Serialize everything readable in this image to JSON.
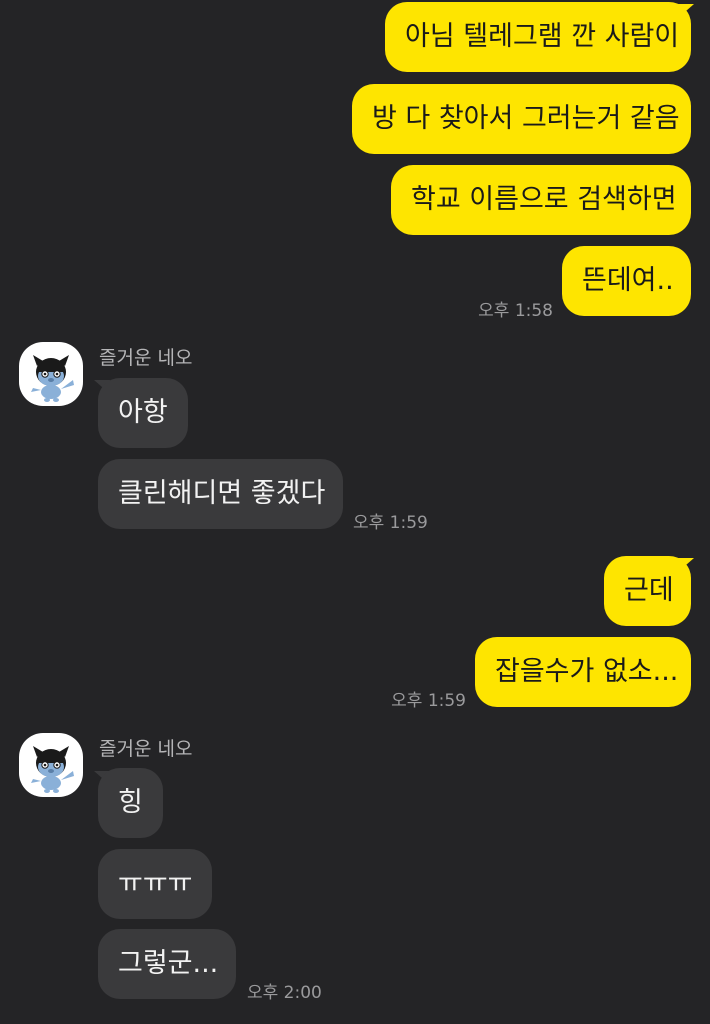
{
  "colors": {
    "background": "#242426",
    "my_bubble": "#FEE500",
    "their_bubble": "#3a3a3c"
  },
  "messages": {
    "m1": "아님 텔레그램 깐 사람이",
    "m2": "방 다 찾아서 그러는거 같음",
    "m3": "학교 이름으로 검색하면",
    "m4": "뜬데여..",
    "t1": "오후 1:58",
    "sender1": "즐거운 네오",
    "m5": "아항",
    "m6": "클린해디면 좋겠다",
    "t2": "오후 1:59",
    "m7": "근데",
    "m8": "잡을수가 없소...",
    "t3": "오후 1:59",
    "sender2": "즐거운 네오",
    "m9": "힝",
    "m10": "ㅠㅠㅠ",
    "m11": "그렇군...",
    "t4": "오후 2:00"
  },
  "icons": {
    "avatar": "neo-character-avatar-icon"
  }
}
